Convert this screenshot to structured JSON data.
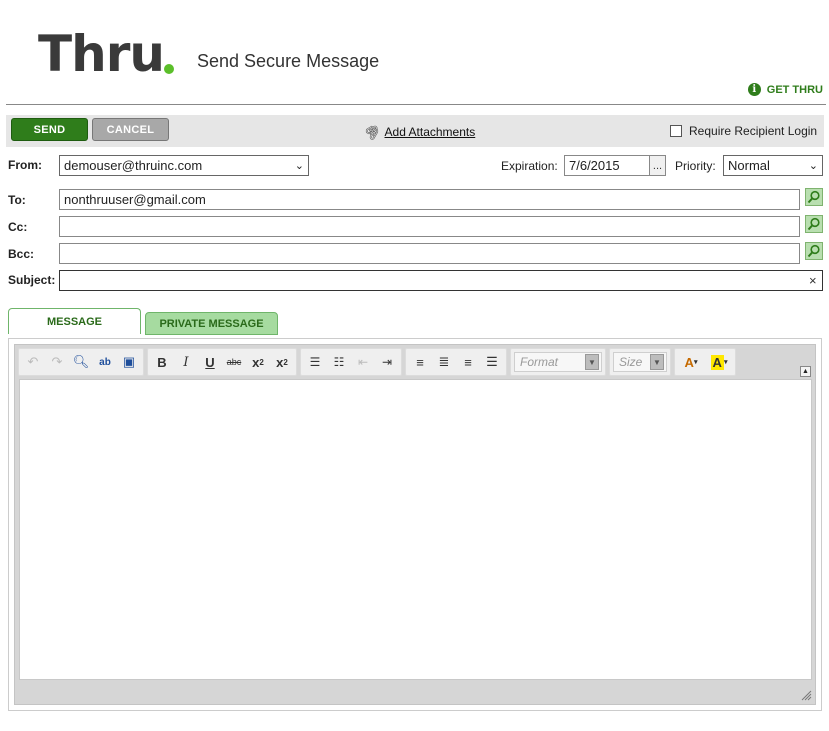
{
  "header": {
    "logo_text": "Thru",
    "logo_dot_color": "#5bbf2a",
    "page_title": "Send Secure Message",
    "get_thru_label": "GET THRU"
  },
  "toolbar": {
    "send_label": "SEND",
    "cancel_label": "CANCEL",
    "attachments_label": "Add Attachments",
    "require_login_label": "Require Recipient Login"
  },
  "form": {
    "from_label": "From:",
    "from_value": "demouser@thruinc.com",
    "expiration_label": "Expiration:",
    "expiration_value": "7/6/2015",
    "expiration_picker_label": "...",
    "priority_label": "Priority:",
    "priority_value": "Normal",
    "to_label": "To:",
    "to_value": "nonthruuser@gmail.com",
    "cc_label": "Cc:",
    "cc_value": "",
    "bcc_label": "Bcc:",
    "bcc_value": "",
    "subject_label": "Subject:",
    "subject_value": "",
    "subject_clear": "×"
  },
  "tabs": {
    "message_label": "MESSAGE",
    "private_label": "PRIVATE MESSAGE"
  },
  "editor": {
    "format_placeholder": "Format",
    "size_placeholder": "Size",
    "bold_label": "B",
    "italic_label": "I",
    "underline_label": "U",
    "strike_label": "abc"
  },
  "colors": {
    "accent_green": "#2f7d1b",
    "tab_green": "#a6dba0",
    "cancel_gray": "#a8a8a8"
  }
}
